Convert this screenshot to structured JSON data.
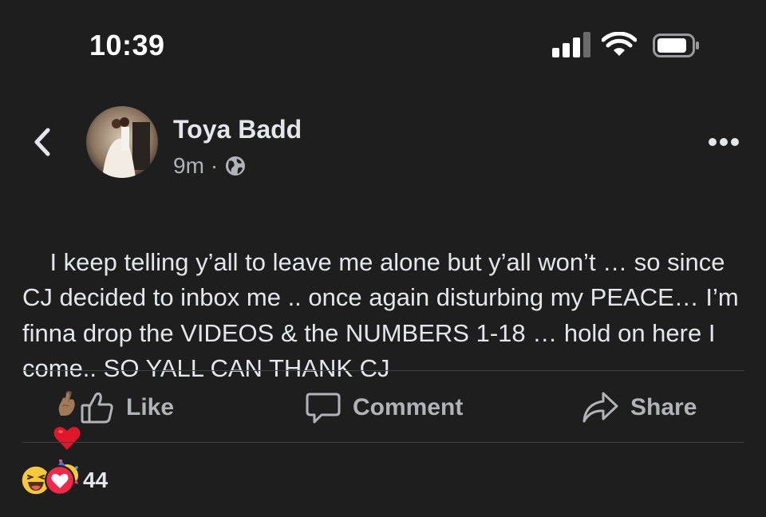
{
  "status_bar": {
    "time": "10:39",
    "signal_icon": "cellular-signal-icon",
    "wifi_icon": "wifi-icon",
    "battery_icon": "battery-icon"
  },
  "post": {
    "author": "Toya Badd",
    "time_ago": "9m",
    "separator": "·",
    "privacy_icon": "globe-icon",
    "text": "I keep telling y’all to leave me alone but y’all won’t … so since CJ decided to inbox me .. once again disturbing my PEACE… I’m finna drop the VIDEOS & the NUMBERS 1-18 … hold on here I come.. SO YALL CAN THANK CJ",
    "emojis": [
      "crossed-fingers-emoji",
      "red-heart-emoji",
      "partying-face-emoji"
    ]
  },
  "actions": {
    "like_label": "Like",
    "comment_label": "Comment",
    "share_label": "Share"
  },
  "reactions": {
    "icons": [
      "haha-reaction-icon",
      "love-reaction-icon"
    ],
    "count": "44"
  },
  "colors": {
    "background": "#1e1e1f",
    "text_primary": "#e4e6eb",
    "text_secondary": "#b0b3b8",
    "divider": "#3e4042",
    "love_red": "#f0284a",
    "haha_yellow": "#f7c83c"
  }
}
